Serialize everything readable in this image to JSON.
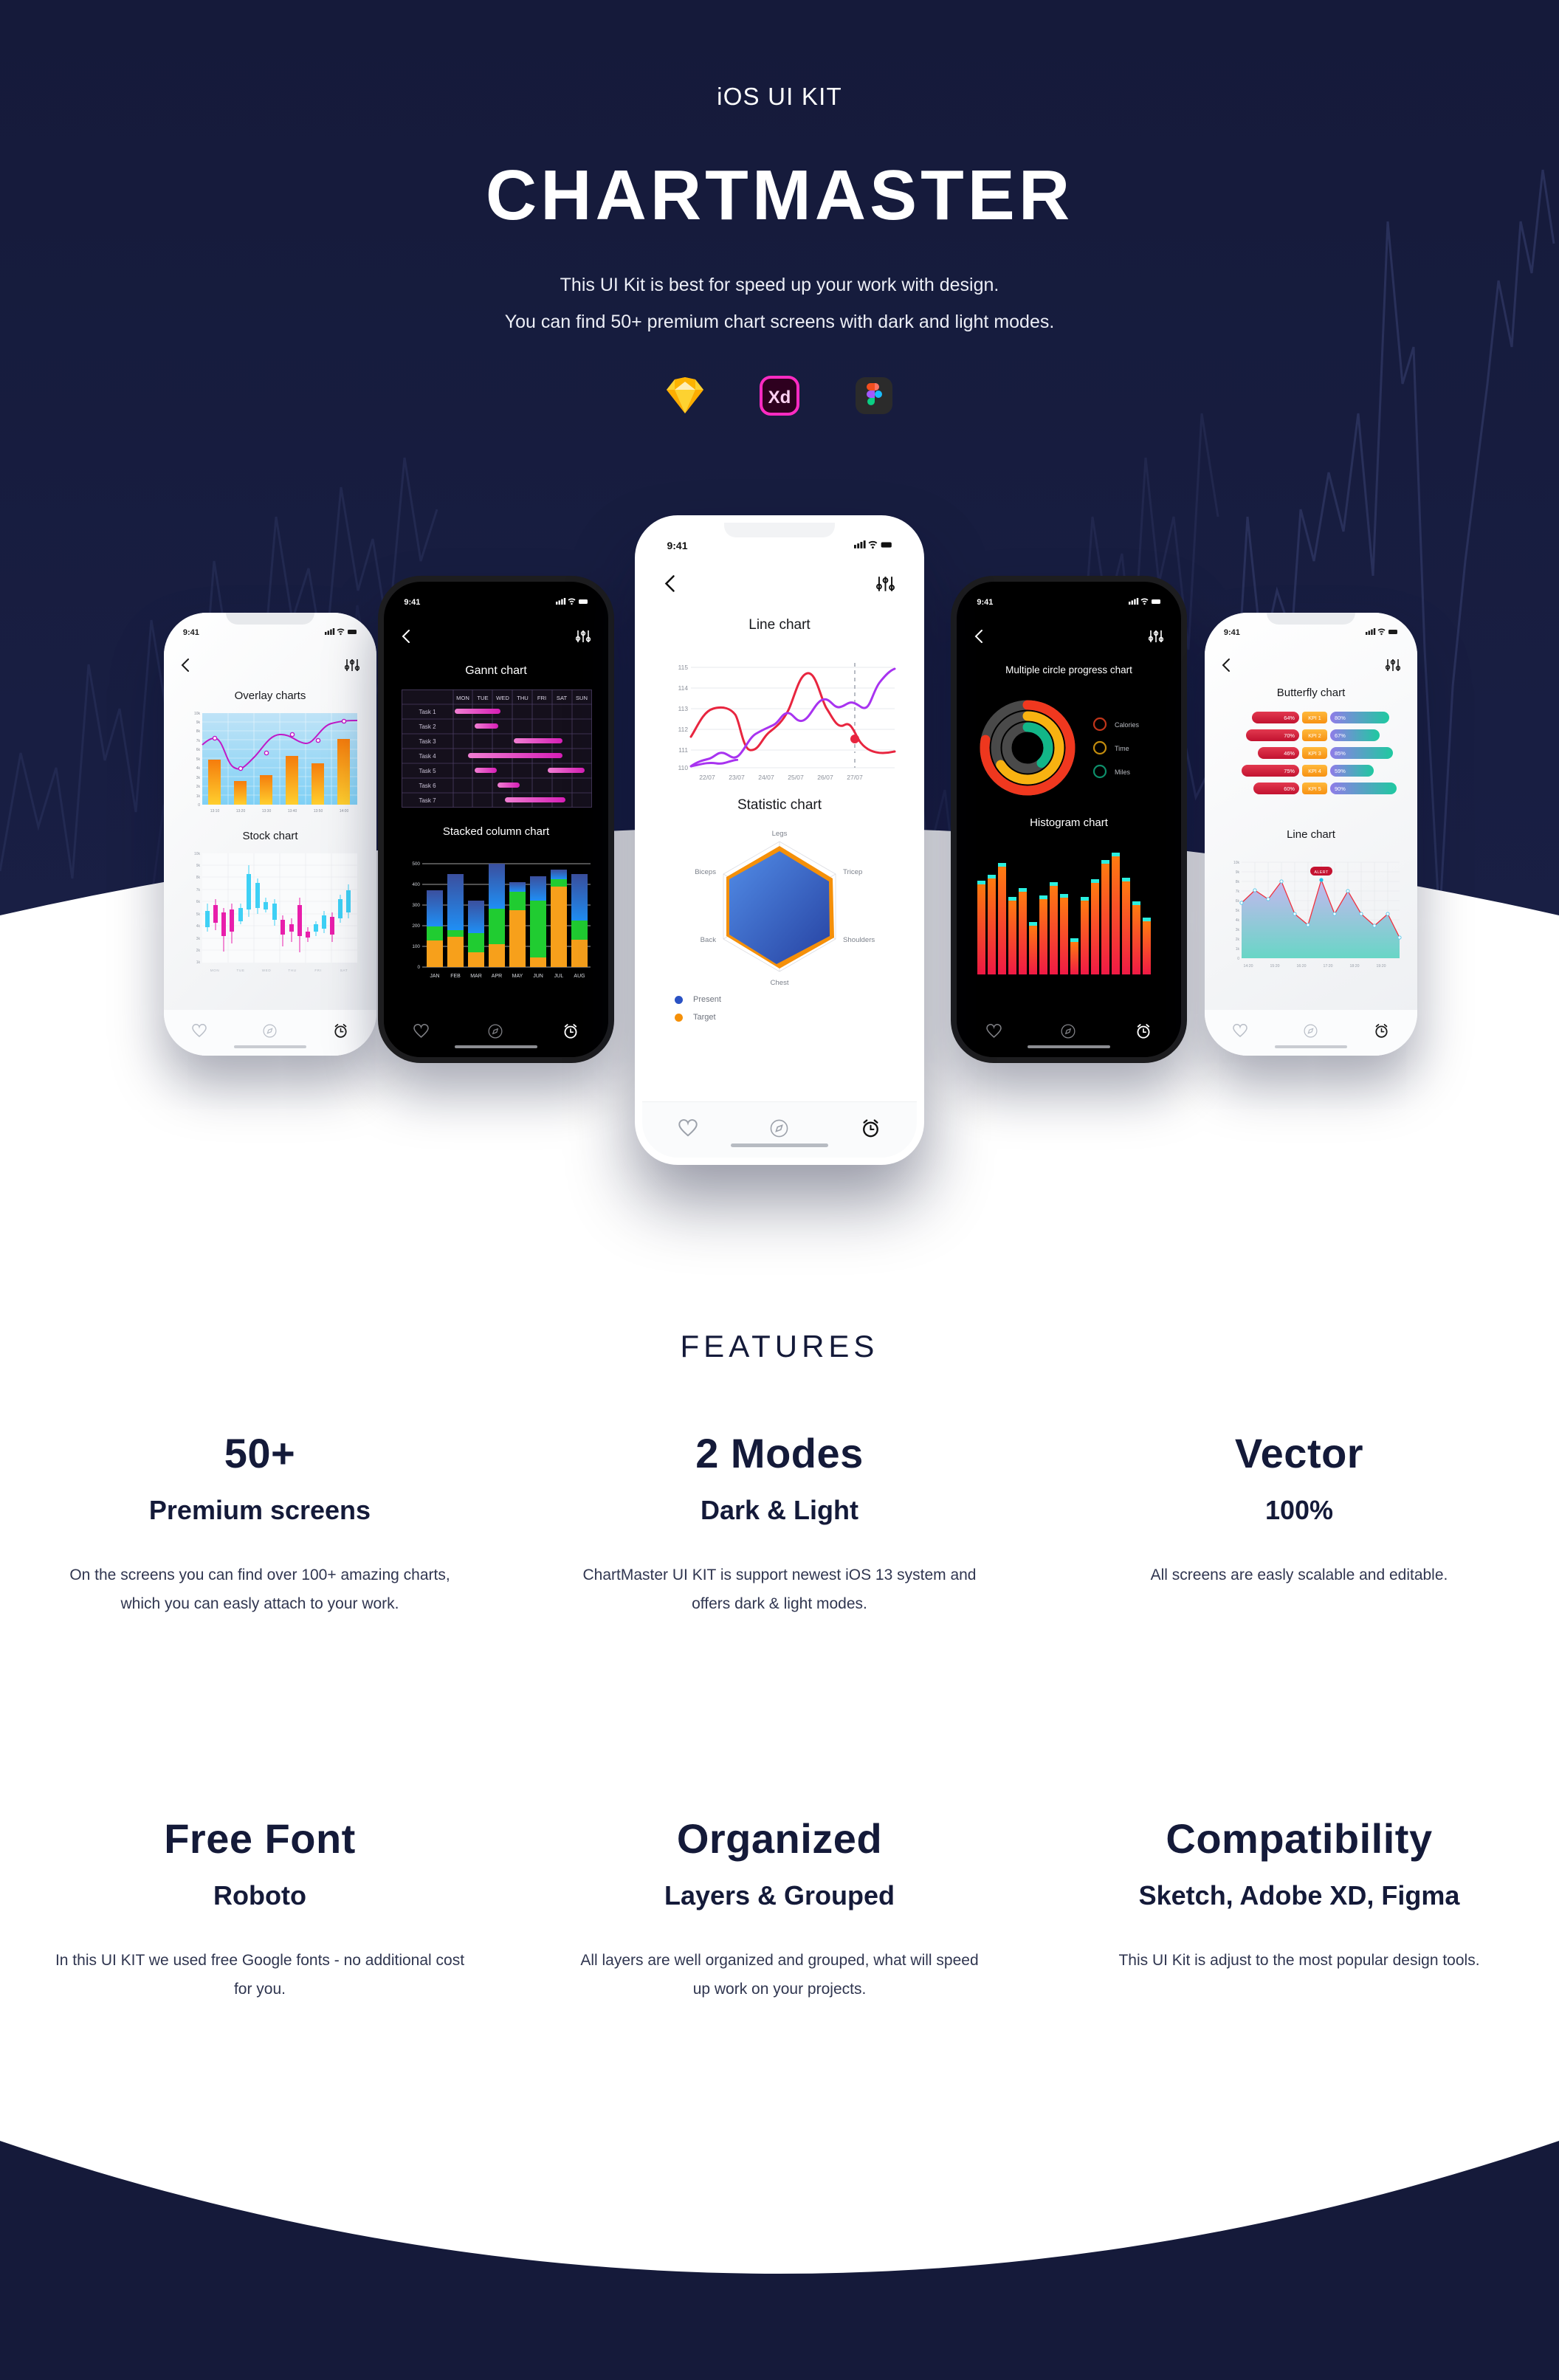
{
  "hero": {
    "kicker": "iOS UI KIT",
    "title": "CHARTMASTER",
    "subtitle_line1": "This UI Kit is best for speed up your work with design.",
    "subtitle_line2": "You can find 50+ premium chart screens with dark and light modes.",
    "background_color": "#151a3a",
    "accent_text_color": "#ffffff",
    "tools": [
      {
        "name": "sketch-icon",
        "label": "Sketch"
      },
      {
        "name": "adobe-xd-icon",
        "label": "Xd"
      },
      {
        "name": "figma-icon",
        "label": "Figma"
      }
    ]
  },
  "phones": [
    {
      "id": "phone-overlay-stock",
      "theme": "light",
      "status_time": "9:41",
      "charts": [
        {
          "title": "Overlay charts",
          "type": "bar",
          "categories": [
            "13:10",
            "13:20",
            "13:30",
            "13:40",
            "13:50",
            "14:00"
          ],
          "values": [
            4900,
            2550,
            3250,
            5300,
            4550,
            7150
          ],
          "line_values": [
            6550,
            7050,
            4800,
            5600,
            7300,
            6650
          ],
          "ylabels": [
            "0",
            "1k",
            "2k",
            "3k",
            "4k",
            "5k",
            "6k",
            "7k",
            "8k",
            "9k",
            "10k"
          ],
          "ylim": [
            0,
            10000
          ]
        },
        {
          "title": "Stock chart",
          "type": "candlestick",
          "categories": [
            "MON",
            "TUE",
            "WED",
            "THU",
            "FRI",
            "SAT"
          ],
          "ylabels": [
            "1k",
            "2k",
            "3k",
            "4k",
            "5k",
            "6k",
            "7k",
            "8k",
            "9k",
            "10k"
          ],
          "ylim": [
            1000,
            10000
          ]
        }
      ]
    },
    {
      "id": "phone-gannt-stacked",
      "theme": "dark",
      "status_time": "9:41",
      "charts": [
        {
          "title": "Gannt chart",
          "type": "table",
          "columns": [
            "",
            "MON",
            "TUE",
            "WED",
            "THU",
            "FRI",
            "SAT",
            "SUN"
          ],
          "rows": [
            "Task 1",
            "Task 2",
            "Task 3",
            "Task 4",
            "Task 5",
            "Task 6",
            "Task 7"
          ],
          "bars": [
            [
              {
                "start": 0,
                "span": 2.4
              }
            ],
            [
              {
                "start": 1.2,
                "span": 1.4
              }
            ],
            [
              {
                "start": 3.6,
                "span": 2.6
              }
            ],
            [
              {
                "start": 0.7,
                "span": 5.3
              }
            ],
            [
              {
                "start": 1.2,
                "span": 1.4
              },
              {
                "start": 5.2,
                "span": 1.8
              }
            ],
            [
              {
                "start": 2.4,
                "span": 1.3
              }
            ],
            [
              {
                "start": 3.0,
                "span": 3.2
              }
            ]
          ]
        },
        {
          "title": "Stacked column chart",
          "type": "bar",
          "categories": [
            "JAN",
            "FEB",
            "MAR",
            "APR",
            "MAY",
            "JUN",
            "JUL",
            "AUG"
          ],
          "series": [
            {
              "name": "orange",
              "values": [
                130,
                148,
                73,
                112,
                275,
                48,
                390,
                132
              ]
            },
            {
              "name": "green",
              "values": [
                68,
                35,
                93,
                172,
                90,
                272,
                35,
                93
              ]
            },
            {
              "name": "blue",
              "values": [
                172,
                272,
                154,
                216,
                45,
                122,
                45,
                225
              ]
            }
          ],
          "ylabels": [
            "0",
            "100",
            "200",
            "300",
            "400",
            "500"
          ],
          "ylim": [
            0,
            500
          ]
        }
      ]
    },
    {
      "id": "phone-line-statistic",
      "theme": "light",
      "status_time": "9:41",
      "charts": [
        {
          "title": "Line chart",
          "type": "line",
          "categories": [
            "22/07",
            "23/07",
            "24/07",
            "25/07",
            "26/07",
            "27/07"
          ],
          "ylabels": [
            "110",
            "111",
            "112",
            "113",
            "114",
            "115"
          ],
          "ylim": [
            110,
            115
          ],
          "series": [
            {
              "name": "red",
              "color": "#e8253f"
            },
            {
              "name": "purple",
              "color": "#a833f0"
            }
          ]
        },
        {
          "title": "Statistic chart",
          "type": "radar",
          "categories": [
            "Legs",
            "Tricep",
            "Shoulders",
            "Chest",
            "Back",
            "Biceps"
          ],
          "series": [
            {
              "name": "Present",
              "color": "#2a52c4",
              "values": [
                82,
                88,
                92,
                78,
                76,
                86
              ]
            },
            {
              "name": "Target",
              "color": "#f59009",
              "values": [
                90,
                92,
                96,
                86,
                84,
                96
              ]
            }
          ],
          "legend": [
            "Present",
            "Target"
          ]
        }
      ]
    },
    {
      "id": "phone-circle-histogram",
      "theme": "dark",
      "status_time": "9:41",
      "charts": [
        {
          "title": "Multiple circle progress chart",
          "type": "pie",
          "rings": [
            {
              "label": "Calories",
              "color": "#f0381f",
              "value": 78
            },
            {
              "label": "Time",
              "color": "#f8b211",
              "value": 66
            },
            {
              "label": "Miles",
              "color": "#12b688",
              "value": 38
            }
          ]
        },
        {
          "title": "Histogram chart",
          "type": "bar",
          "values": [
            70,
            74,
            82,
            60,
            66,
            40,
            62,
            72,
            64,
            28,
            63,
            75,
            88,
            94,
            74,
            58,
            46
          ]
        }
      ]
    },
    {
      "id": "phone-butterfly-line",
      "theme": "light",
      "status_time": "9:41",
      "charts": [
        {
          "title": "Butterfly chart",
          "type": "bar",
          "categories": [
            "KPI 1",
            "KPI 2",
            "KPI 3",
            "KPI 4",
            "KPI 5"
          ],
          "left_values": [
            "64%",
            "70%",
            "46%",
            "75%",
            "60%"
          ],
          "right_values": [
            "80%",
            "67%",
            "85%",
            "59%",
            "90%"
          ]
        },
        {
          "title": "Line chart",
          "type": "area",
          "categories": [
            "14:20",
            "15:20",
            "16:20",
            "17:20",
            "18:20",
            "19:20"
          ],
          "values": [
            5800,
            7050,
            6150,
            4600,
            3450,
            8150,
            4600,
            7000,
            4600,
            3350,
            4600,
            2150
          ],
          "ylabels": [
            "0",
            "1k",
            "2k",
            "3k",
            "4k",
            "5k",
            "6k",
            "7k",
            "8k",
            "9k",
            "10k"
          ],
          "ylim": [
            0,
            10000
          ],
          "annotation": "ALERT"
        }
      ]
    }
  ],
  "features": {
    "heading": "FEATURES",
    "row1": [
      {
        "big": "50+",
        "sub": "Premium screens",
        "body": "On the screens you can find over 100+ amazing charts, which you can easly attach to your work."
      },
      {
        "big": "2 Modes",
        "sub": "Dark & Light",
        "body": "ChartMaster UI KIT is support newest iOS 13 system and offers dark & light modes."
      },
      {
        "big": "Vector",
        "sub": "100%",
        "body": "All screens are easly scalable and editable."
      }
    ],
    "row2": [
      {
        "big": "Free Font",
        "sub": "Roboto",
        "body": "In this UI KIT we used free Google fonts - no additional cost for you."
      },
      {
        "big": "Organized",
        "sub": "Layers & Grouped",
        "body": "All layers are well organized and grouped, what will speed up work on your projects."
      },
      {
        "big": "Compatibility",
        "sub": "Sketch, Adobe XD, Figma",
        "body": "This UI Kit is adjust to the most popular design tools."
      }
    ]
  }
}
